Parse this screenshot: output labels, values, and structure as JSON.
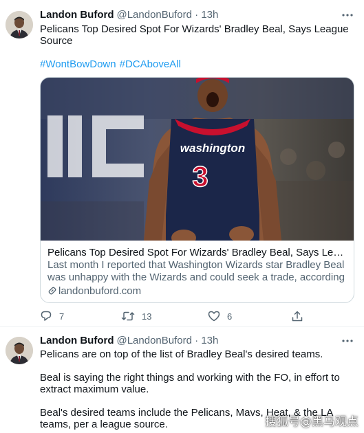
{
  "tweets": [
    {
      "author": {
        "name": "Landon Buford",
        "handle": "@LandonBuford",
        "time": "13h"
      },
      "text": [
        "Pelicans Top Desired Spot For Wizards' Bradley Beal, Says League Source"
      ],
      "hashtags": [
        "#WontBowDown",
        "#DCAboveAll"
      ],
      "card": {
        "title": "Pelicans Top Desired Spot For Wizards' Bradley Beal, Says League S...",
        "description": "Last month I reported that Washington Wizards star Bradley Beal was unhappy with the Wizards and could seek a trade, according to a ...",
        "domain": "landonbuford.com",
        "image_text": {
          "jersey_team": "washington",
          "jersey_number": "3"
        }
      },
      "actions": {
        "replies": "7",
        "retweets": "13",
        "likes": "6"
      }
    },
    {
      "author": {
        "name": "Landon Buford",
        "handle": "@LandonBuford",
        "time": "13h"
      },
      "text": [
        "Pelicans are on top of the list of Bradley Beal's desired teams.",
        "Beal is saying the right things and working with the FO, in effort to extract maximum value.",
        "Beal's desired teams include the Pelicans, Mavs, Heat, & the LA teams, per a league source."
      ]
    }
  ],
  "separator_dot": "·",
  "watermark": "搜狐号@黑马观点",
  "colors": {
    "link": "#1d9bf0",
    "secondary_text": "#536471",
    "primary_text": "#0f1419",
    "border": "#cfd9de",
    "jersey_navy": "#1b2649",
    "jersey_red": "#c8102e"
  },
  "icons": {
    "more": "more-horizontal-icon",
    "reply": "reply-icon",
    "retweet": "retweet-icon",
    "like": "heart-icon",
    "share": "share-icon",
    "link": "link-icon"
  }
}
